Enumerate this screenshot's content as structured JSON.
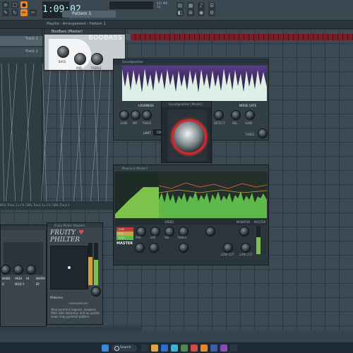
{
  "topbar": {
    "time": "1:09:02",
    "pattern": "Pattern 1",
    "cpu": "441 MB",
    "cpu_sub": "13"
  },
  "playlist": {
    "title": "Playlist - Arrangement › Pattern 1",
    "track1": "Track 1",
    "track2": "Track 2",
    "bottom_tracks": "BOG  Track 1 ▸  FX / DRL  Track 1 ▸  FX / DRL  Track 1"
  },
  "boobass": {
    "title": "BooBass (Master)",
    "logo": "BOOBASS",
    "knob_labels": [
      "BASS",
      "MID",
      "TREBLE"
    ]
  },
  "wave_plugin": {
    "title": "Soundgoodizer",
    "section_left": "LOUDNESS",
    "section_right": "NOISE GATE",
    "knob_labels_left": [
      "GAIN",
      "MP",
      "THRES"
    ],
    "knob_labels_right": [
      "DETECT",
      "REL",
      "GAIN",
      "THRES"
    ],
    "limit_label": "LIMIT",
    "comp_label": "COMP"
  },
  "ring_plugin": {
    "title": "Soundgoodizer (Master)"
  },
  "maximus": {
    "title": "Maximus (Master)",
    "bar_labels": [
      "SPEED",
      "MONITOR",
      "MASTER"
    ],
    "bands": [
      "LOW",
      "MID",
      "HIGH",
      "MASTER"
    ],
    "master_label": "MASTER",
    "knob_labels": [
      "PRE",
      "LMT",
      "REL",
      "THRES",
      "LOW CUT",
      "LOW CUT"
    ]
  },
  "fruity_philter": {
    "title": "Fruity Philter (Master)",
    "name_line1": "FRUITY",
    "name_line2": "PHILTER",
    "mode_label": "Midsome",
    "oversample": "OVERSAMPLING",
    "description": "Step pyramid lowpass. Lowpass filter with distortion and an upside down step pyramid pattern."
  },
  "left_panel": {
    "labels": [
      "BAND",
      "HIGH",
      "HI",
      "WARM",
      "X",
      "MOD Y",
      "BY"
    ]
  },
  "taskbar": {
    "search": "Search"
  }
}
